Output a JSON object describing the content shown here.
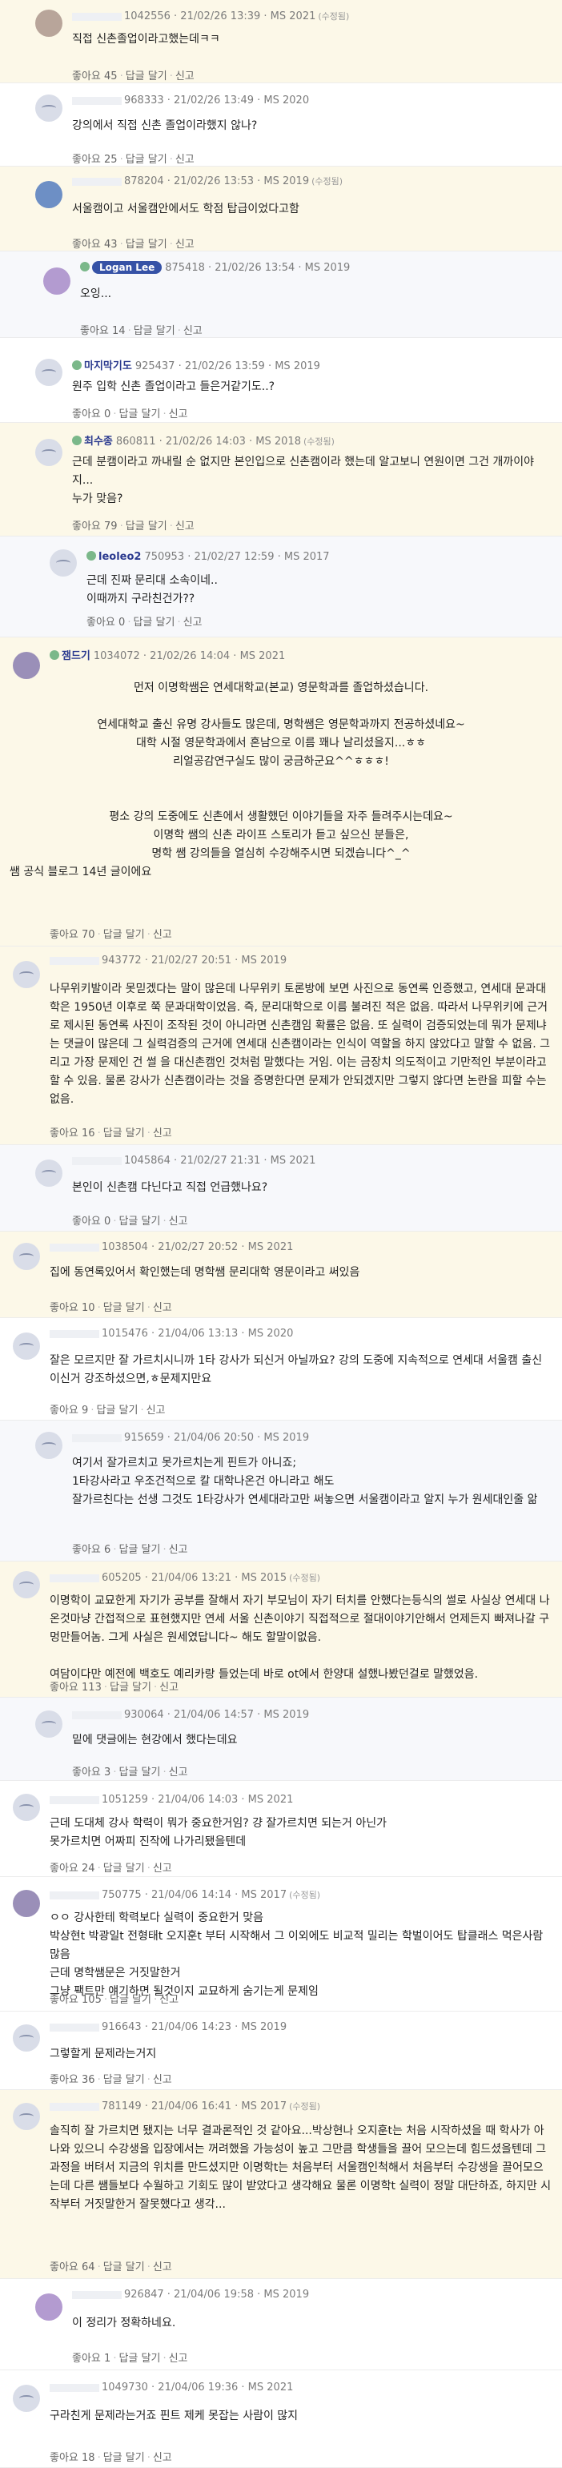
{
  "comments": [
    {
      "meta": "1042556 · 21/02/26 13:39 · MS 2021",
      "edited": "(수정됨)",
      "body": "직접 신촌졸업이라고했는데ㅋㅋ",
      "likes": "45"
    },
    {
      "meta": "968333 · 21/02/26 13:49 · MS 2020",
      "body": "강의에서 직접 신촌 졸업이라했지 않나?",
      "likes": "25"
    },
    {
      "meta": "878204 · 21/02/26 13:53 · MS 2019",
      "edited": "(수정됨)",
      "body": "서울캠이고 서울캠안에서도 학점 탑급이었다고함",
      "likes": "43"
    },
    {
      "pill": "Logan Lee",
      "meta": "875418 · 21/02/26 13:54 · MS 2019",
      "body": "오잉...",
      "likes": "14"
    },
    {
      "nick": "마지막기도",
      "meta": "925437 · 21/02/26 13:59 · MS 2019",
      "body": "원주 입학 신촌 졸업이라고 들은거같기도..?",
      "likes": "0"
    },
    {
      "nick": "최수종",
      "meta": "860811 · 21/02/26 14:03 · MS 2018",
      "edited": "(수정됨)",
      "body": "근데 분캠이라고 까내릴 순 없지만 본인입으로 신촌캠이라 했는데 알고보니 연원이면 그건 개까이야지...\n누가 맞음?",
      "likes": "79"
    },
    {
      "nick": "leoleo2",
      "meta": "750953 · 21/02/27 12:59 · MS 2017",
      "body": "근데 진짜 문리대 소속이네..\n이때까지 구라친건가??",
      "likes": "0"
    },
    {
      "nick": "잼드기",
      "meta": "1034072 · 21/02/26 14:04 · MS 2021",
      "centered": "먼저 이명학쌤은 연세대학교(본교) 영문학과를 졸업하셨습니다.\n\n연세대학교 출신 유명 강사들도 많은데, 명학쌤은 영문학과까지 전공하셨네요~\n대학 시절 영문학과에서 혼남으로 이름 꽤나 날리셨을지...ㅎㅎ\n리얼공감연구실도 많이 궁금하군요^^ㅎㅎㅎ!\n\n\n평소 강의 도중에도 신촌에서 생활했던 이야기들을 자주 들려주시는데요~\n이명학 쌤의 신촌 라이프 스토리가 듣고 싶으신 분들은,\n명학 쌤 강의들을 열심히 수강해주시면 되겠습니다^_^",
      "tail": "쌤 공식 블로그 14년 글이에요",
      "likes": "70"
    },
    {
      "meta": "943772 · 21/02/27 20:51 · MS 2019",
      "body": "나무위키발이라 못믿겠다는 말이 많은데 나무위키 토론방에 보면 사진으로 동연록 인증했고, 연세대 문과대학은 1950년 이후로 쭉 문과대학이었음. 즉, 문리대학으로 이름 불려진 적은 없음. 따라서 나무위키에 근거로 제시된 동연록 사진이 조작된 것이 아니라면 신촌캠임 확률은 없음. 또 실력이 검증되었는데 뭐가 문제냐는 댓글이 많은데 그 실력검증의 근거에 연세대 신촌캠이라는 인식이 역할을 하지 않았다고 말할 수 없음. 그리고 가장 문제인 건 썰 을 대신촌캠인 것처럼 말했다는 거임. 이는 금장치 의도적이고 기만적인 부분이라고 할 수 있음. 물론 강사가 신촌캠이라는 것을 증명한다면 문제가 안되겠지만 그렇지 않다면 논란을 피할 수는 없음.",
      "likes": "16"
    },
    {
      "meta": "1045864 · 21/02/27 21:31 · MS 2021",
      "body": "본인이 신촌캠 다닌다고 직접 언급했나요?",
      "likes": "0"
    },
    {
      "meta": "1038504 · 21/02/27 20:52 · MS 2021",
      "body": "집에 동연록있어서 확인했는데 명학쌤 문리대학 영문이라고 써있음",
      "likes": "10"
    },
    {
      "meta": "1015476 · 21/04/06 13:13 · MS 2020",
      "body": "잘은 모르지만 잘 가르치시니까 1타 강사가 되신거 아닐까요? 강의 도중에 지속적으로 연세대 서울캠 출신이신거 강조하셨으면,ㅎ문제지만요",
      "likes": "9"
    },
    {
      "meta": "915659 · 21/04/06 20:50 · MS 2019",
      "body": "여기서 잘가르치고 못가르치는게 핀트가 아니죠;\n1타강사라고 우조건적으로 칼 대학나온건 아니라고 해도\n잘가르친다는 선생 그것도 1타강사가 연세대라고만 써놓으면 서울캠이라고 알지 누가 원세대인줄 앎",
      "likes": "6"
    },
    {
      "meta": "605205 · 21/04/06 13:21 · MS 2015",
      "edited": "(수정됨)",
      "body": "이명학이 교묘한게 자기가 공부를 잘해서 자기 부모님이 자기 터치를 안했다는등식의 썰로 사실상 연세대 나온것마냥 간접적으로 표현했지만 연세 서울 신촌이야기 직접적으로 절대이야기안해서 언제든지 빠져나갈 구멍만들어놈. 그게 사실은 원세였답니다~ 해도 할말이없음.\n\n여담이다만 예전에 백호도 예리카랑 들었는데 바로 ot에서 한양대 설했나봤던걸로 말했었음.",
      "likes": "113"
    },
    {
      "meta": "930064 · 21/04/06 14:57 · MS 2019",
      "body": "밑에 댓글에는 현강에서 했다는데요",
      "likes": "3"
    },
    {
      "meta": "1051259 · 21/04/06 14:03 · MS 2021",
      "body": "근데 도대체 강사 학력이 뭐가 중요한거임? 걍 잘가르치면 되는거 아닌가\n못가르치면 어짜피 진작에 나가리됐을텐데",
      "likes": "24"
    },
    {
      "meta": "750775 · 21/04/06 14:14 · MS 2017",
      "edited": "(수정됨)",
      "body": "ㅇㅇ 강사한테 학력보다 실력이 중요한거 맞음\n박상현t 박광일t 전형태t 오지훈t 부터 시작해서 그 이외에도 비교적 밀리는 학벌이어도 탑클래스 먹은사람많음\n근데 명학쌤문은 거짓말한거\n그냥 팩트만 얘기하면 될것이지 교묘하게 숨기는게 문제임",
      "likes": "105"
    },
    {
      "meta": "916643 · 21/04/06 14:23 · MS 2019",
      "body": "그렇할게 문제라는거지",
      "likes": "36"
    },
    {
      "meta": "781149 · 21/04/06 16:41 · MS 2017",
      "edited": "(수정됨)",
      "body": "솔직히 잘 가르치면 됐지는 너무 결과론적인 것 같아요...박상현나 오지훈t는 처음 시작하셨을 때 학사가 아나와 있으니 수강생을 입장에서는 꺼려했을 가능성이 높고 그만큼 학생들을 끌어 모으는데 힘드셨을텐데 그 과정을 버텨서 지금의 위치를 만드셨지만 이명학t는 처음부터 서울캠인척해서 처음부터 수강생을 끌어모으는데 다른 쌤들보다 수월하고 기회도 많이 받았다고 생각해요 물론 이명학t 실력이 정말 대단하죠, 하지만 시작부터 거짓말한거 잘못했다고 생각...",
      "likes": "64"
    },
    {
      "meta": "926847 · 21/04/06 19:58 · MS 2019",
      "body": "이 정리가 정확하네요.",
      "likes": "1"
    },
    {
      "meta": "1049730 · 21/04/06 19:36 · MS 2021",
      "body": "구라친게 문제라는거죠 핀트 제케 못잡는 사람이 많지",
      "likes": "18"
    }
  ],
  "actions": {
    "like_prefix": "좋아요",
    "reply": "답글 달기",
    "report": "신고"
  }
}
